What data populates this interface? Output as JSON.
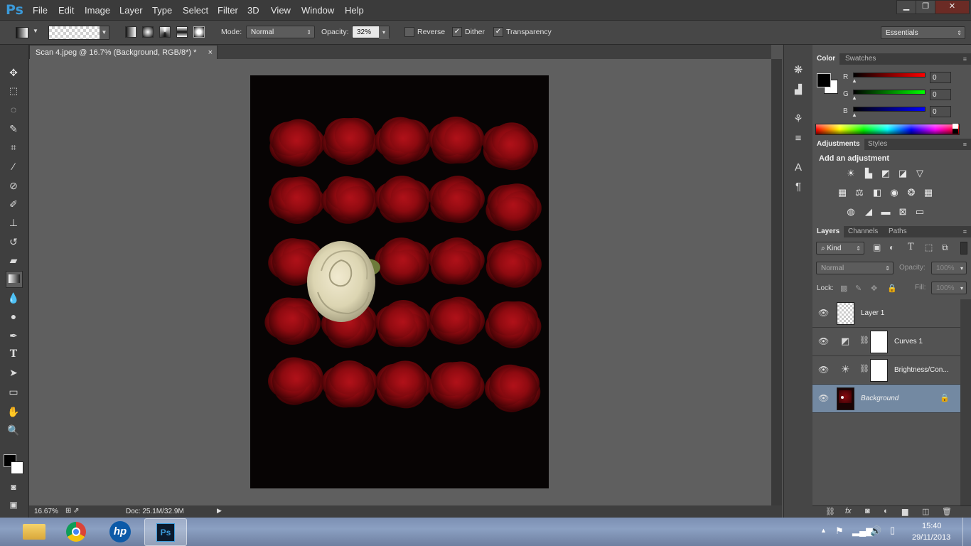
{
  "app": {
    "logo": "Ps"
  },
  "menu": [
    "File",
    "Edit",
    "Image",
    "Layer",
    "Type",
    "Select",
    "Filter",
    "3D",
    "View",
    "Window",
    "Help"
  ],
  "window_controls": {
    "minimize": "▁",
    "restore": "❐",
    "close": "✕"
  },
  "options_bar": {
    "mode_label": "Mode:",
    "mode_value": "Normal",
    "opacity_label": "Opacity:",
    "opacity_value": "32%",
    "reverse_label": "Reverse",
    "dither_label": "Dither",
    "transparency_label": "Transparency",
    "reverse_checked": false,
    "dither_checked": true,
    "transparency_checked": true,
    "workspace": "Essentials"
  },
  "document": {
    "tab_title": "Scan 4.jpeg @ 16.7% (Background, RGB/8*) *",
    "tab_close": "×",
    "zoom": "16.67%",
    "doc_info": "Doc: 25.1M/32.9M"
  },
  "color_panel": {
    "tabs": [
      "Color",
      "Swatches"
    ],
    "channels": [
      {
        "label": "R",
        "value": "0",
        "color": "#ff0000"
      },
      {
        "label": "G",
        "value": "0",
        "color": "#00ff00"
      },
      {
        "label": "B",
        "value": "0",
        "color": "#0000ff"
      }
    ],
    "foreground": "#000000",
    "background": "#ffffff"
  },
  "adjustments_panel": {
    "tabs": [
      "Adjustments",
      "Styles"
    ],
    "heading": "Add an adjustment"
  },
  "layers_panel": {
    "tabs": [
      "Layers",
      "Channels",
      "Paths"
    ],
    "filter_label": "Kind",
    "blend_mode": "Normal",
    "opacity_label": "Opacity:",
    "opacity_value": "100%",
    "lock_label": "Lock:",
    "fill_label": "Fill:",
    "fill_value": "100%",
    "layers": [
      {
        "name": "Layer 1"
      },
      {
        "name": "Curves 1"
      },
      {
        "name": "Brightness/Con..."
      },
      {
        "name": "Background"
      }
    ]
  },
  "taskbar": {
    "time": "15:40",
    "date": "29/11/2013",
    "ps_label": "Ps"
  }
}
